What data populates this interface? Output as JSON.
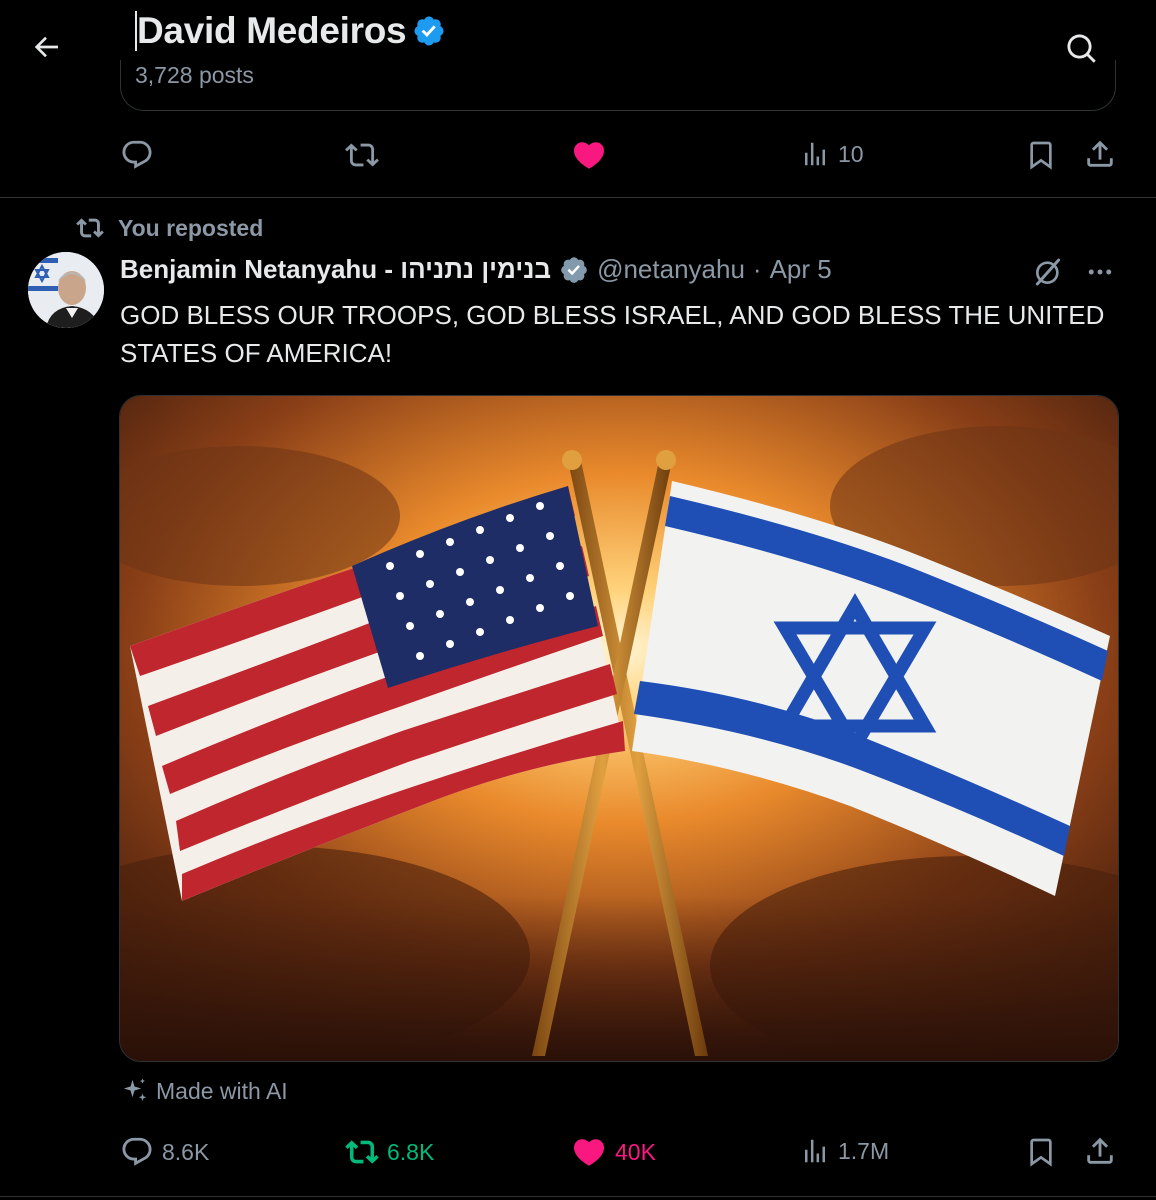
{
  "header": {
    "title": "David Medeiros",
    "posts_count": "3,728 posts",
    "icons": {
      "back": "arrow-left-icon",
      "verified": "verified-badge-icon",
      "search": "search-icon"
    }
  },
  "previous_post": {
    "actions": {
      "views": "10"
    },
    "liked": true
  },
  "repost": {
    "label": "You reposted"
  },
  "post": {
    "author_name": "Benjamin Netanyahu - בנימין נתניהו",
    "handle": "@netanyahu",
    "separator": "·",
    "date": "Apr 5",
    "text": "GOD BLESS OUR TROOPS, GOD BLESS ISRAEL, AND GOD BLESS THE UNITED STATES OF AMERICA!",
    "ai_label": "Made with AI",
    "actions": {
      "replies": "8.6K",
      "reposts": "6.8K",
      "likes": "40K",
      "views": "1.7M"
    },
    "liked": true,
    "reposted": true
  },
  "colors": {
    "background": "#000000",
    "text": "#e7e9ea",
    "secondary_text": "#8b98a5",
    "like_pink": "#f91880",
    "repost_green": "#00ba7c",
    "verified_blue": "#1d9bf0",
    "border": "#2f3336"
  }
}
